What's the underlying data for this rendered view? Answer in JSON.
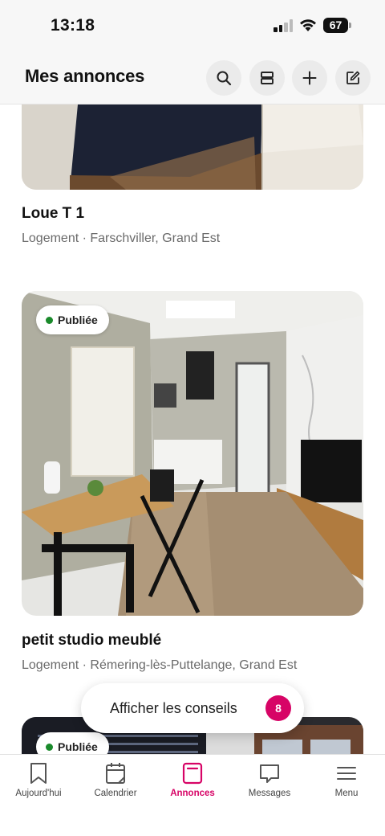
{
  "status_bar": {
    "time": "13:18",
    "battery": "67"
  },
  "header": {
    "title": "Mes annonces"
  },
  "header_icons": [
    "search-icon",
    "layout-icon",
    "plus-icon",
    "edit-icon"
  ],
  "listings": [
    {
      "title": "Loue T 1",
      "subtitle": "Logement · Farschviller, Grand Est",
      "badge": ""
    },
    {
      "title": "petit studio meublé",
      "subtitle": "Logement · Rémering-lès-Puttelange, Grand Est",
      "badge": "Publiée"
    },
    {
      "title": "",
      "subtitle": "",
      "badge": "Publiée"
    }
  ],
  "tips": {
    "label": "Afficher les conseils",
    "count": "8"
  },
  "nav": {
    "items": [
      {
        "label": "Aujourd'hui",
        "icon": "bookmark-icon"
      },
      {
        "label": "Calendrier",
        "icon": "calendar-icon"
      },
      {
        "label": "Annonces",
        "icon": "listing-icon"
      },
      {
        "label": "Messages",
        "icon": "message-icon"
      },
      {
        "label": "Menu",
        "icon": "menu-icon"
      }
    ],
    "active": "Annonces"
  },
  "colors": {
    "accent": "#d70466",
    "published_dot": "#1a8a2b",
    "header_bg": "#f7f7f7"
  }
}
